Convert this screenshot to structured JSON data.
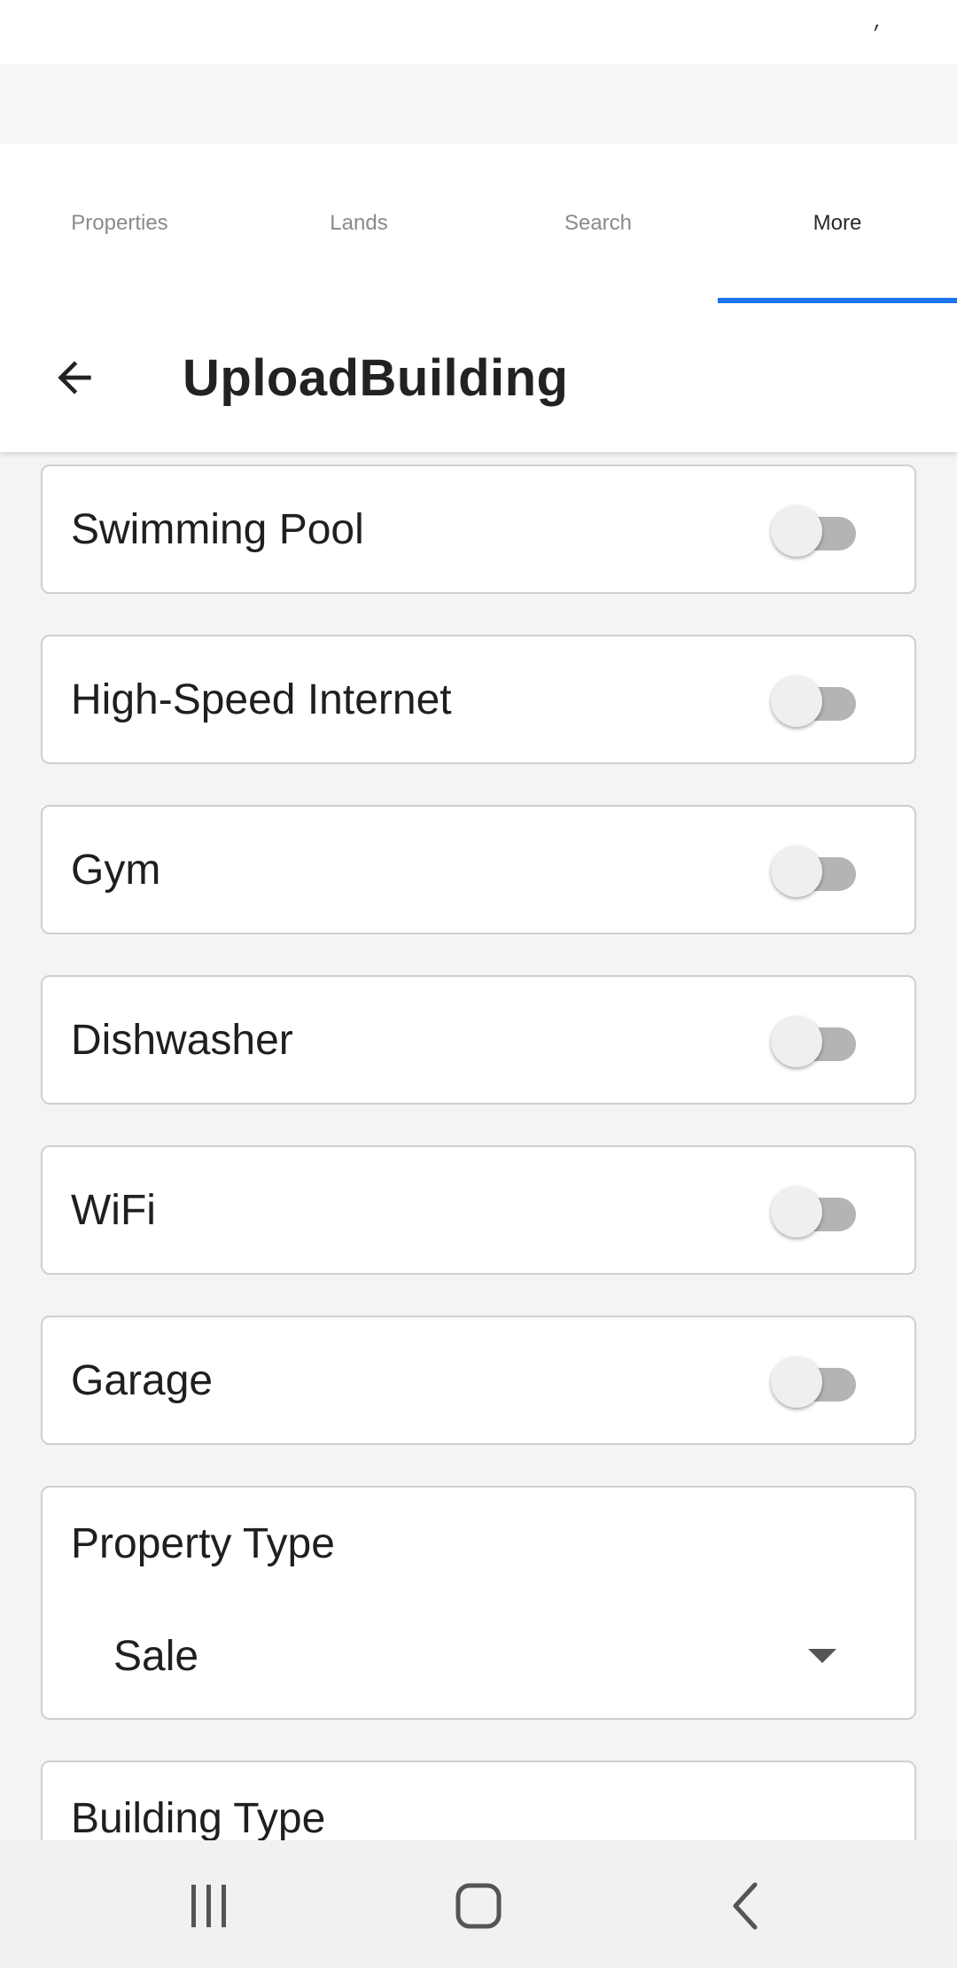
{
  "status_bar": {
    "mark": "′"
  },
  "tabs": [
    {
      "label": "Properties",
      "active": false
    },
    {
      "label": "Lands",
      "active": false
    },
    {
      "label": "Search",
      "active": false
    },
    {
      "label": "More",
      "active": true
    }
  ],
  "accent_color": "#1a73e8",
  "appbar": {
    "title": "UploadBuilding",
    "back_icon": "arrow-left-icon"
  },
  "amenities": [
    {
      "label": "Swimming Pool",
      "enabled": false
    },
    {
      "label": "High-Speed Internet",
      "enabled": false
    },
    {
      "label": "Gym",
      "enabled": false
    },
    {
      "label": "Dishwasher",
      "enabled": false
    },
    {
      "label": "WiFi",
      "enabled": false
    },
    {
      "label": "Garage",
      "enabled": false
    }
  ],
  "property_type": {
    "label": "Property Type",
    "value": "Sale"
  },
  "building_type": {
    "label": "Building Type"
  },
  "nav_bar": {
    "recents_icon": "recents-icon",
    "home_icon": "home-icon",
    "back_icon": "back-chevron-icon"
  }
}
